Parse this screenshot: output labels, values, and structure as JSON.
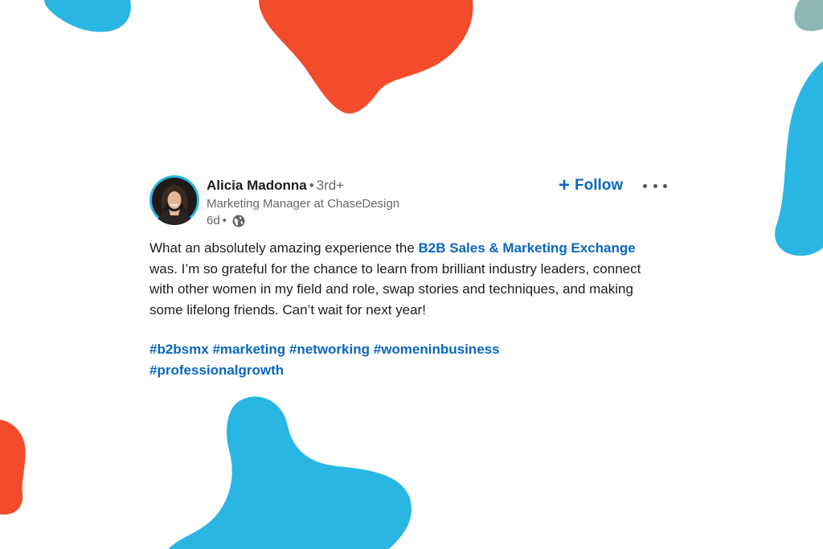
{
  "colors": {
    "blob_red": "#f24c2c",
    "blob_blue": "#29b6e3",
    "blob_teal": "#8db8b3",
    "link": "#0a66c2",
    "text": "#1d1d1d",
    "muted": "#666666"
  },
  "post": {
    "author": {
      "name": "Alicia Madonna",
      "separator": "•",
      "degree": "3rd+",
      "headline": "Marketing Manager at ChaseDesign",
      "time": "6d",
      "time_separator": "•",
      "visibility_icon": "globe-icon"
    },
    "follow_plus": "+",
    "follow_label": "Follow",
    "more_icon": "more-options-icon",
    "body": {
      "part1": "What an absolutely amazing experience the ",
      "link": "B2B Sales & Marketing Exchange",
      "part2": " was. I’m so grateful for the chance to learn from brilliant industry leaders, connect with other women in my field and role, swap stories and techniques, and making some lifelong friends. Can’t wait for next year!"
    },
    "hashtags": [
      "#b2bsmx",
      "#marketing",
      "#networking",
      "#womeninbusiness",
      "#professionalgrowth"
    ]
  }
}
